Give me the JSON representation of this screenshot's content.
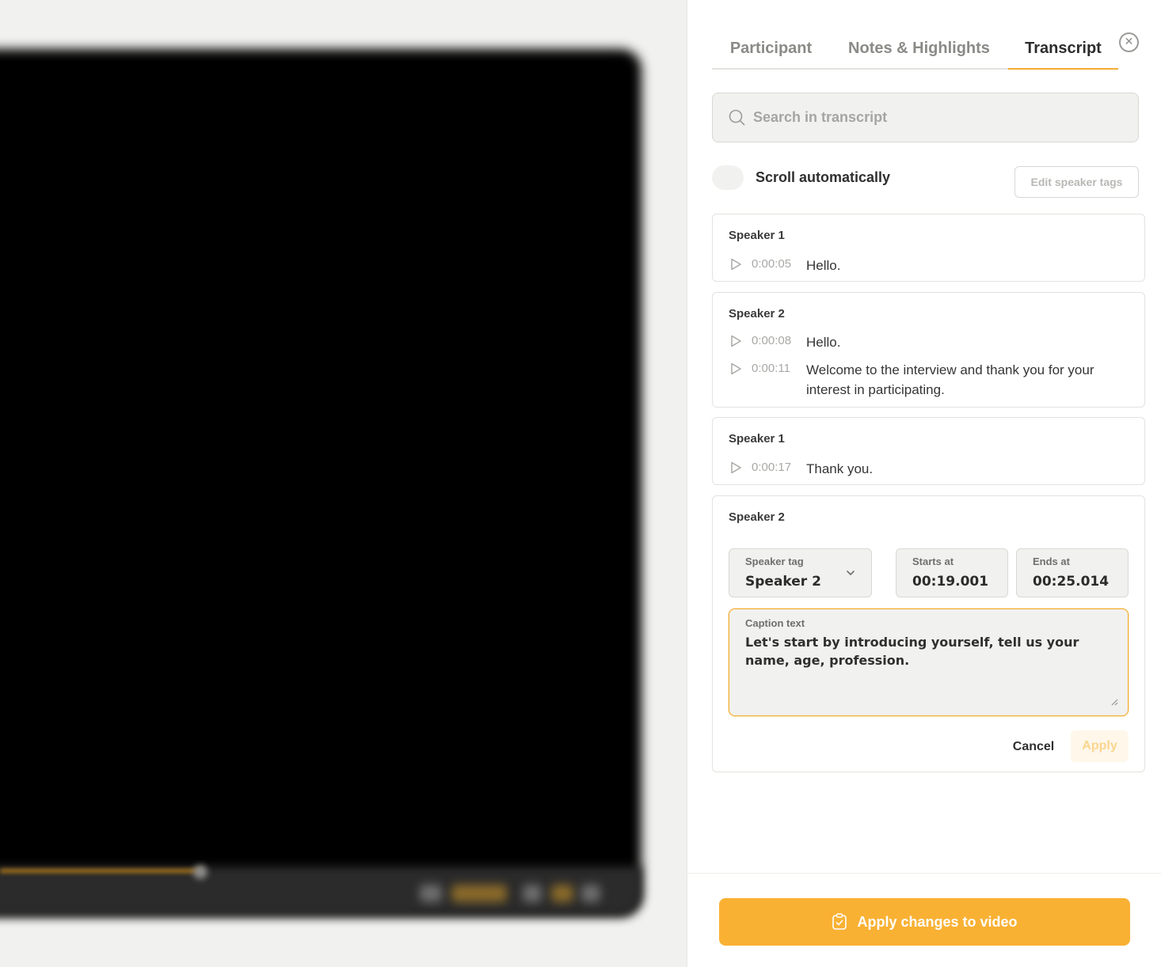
{
  "tabs": [
    {
      "label": "Participant"
    },
    {
      "label": "Notes & Highlights"
    },
    {
      "label": "Transcript"
    }
  ],
  "active_tab": "Transcript",
  "search": {
    "placeholder": "Search in transcript"
  },
  "scroll_toggle": {
    "label": "Scroll automatically",
    "on": false
  },
  "edit_tags_label": "Edit speaker tags",
  "transcript": [
    {
      "speaker": "Speaker 1",
      "lines": [
        {
          "time": "0:00:05",
          "text": "Hello."
        }
      ]
    },
    {
      "speaker": "Speaker 2",
      "lines": [
        {
          "time": "0:00:08",
          "text": "Hello."
        },
        {
          "time": "0:00:11",
          "text": "Welcome to the interview and thank you for your interest in participating."
        }
      ]
    },
    {
      "speaker": "Speaker 1",
      "lines": [
        {
          "time": "0:00:17",
          "text": "Thank you."
        }
      ]
    }
  ],
  "editor": {
    "speaker": "Speaker 2",
    "speaker_tag_label": "Speaker tag",
    "speaker_tag_value": "Speaker 2",
    "starts_label": "Starts at",
    "starts_value": "00:19.001",
    "ends_label": "Ends at",
    "ends_value": "00:25.014",
    "caption_label": "Caption text",
    "caption_value": "Let's start by introducing yourself, tell us your name, age, profession.",
    "cancel_label": "Cancel",
    "apply_label": "Apply"
  },
  "footer": {
    "apply_video_label": "Apply changes to video"
  },
  "colors": {
    "accent": "#f9b134",
    "tab_underline": "#f5ab33",
    "panel_bg": "#ffffff",
    "field_bg": "#f1f1ef"
  },
  "icons": [
    "close-icon",
    "search-icon",
    "play-icon",
    "chevron-down-icon",
    "resize-handle-icon",
    "clipboard-check-icon"
  ]
}
